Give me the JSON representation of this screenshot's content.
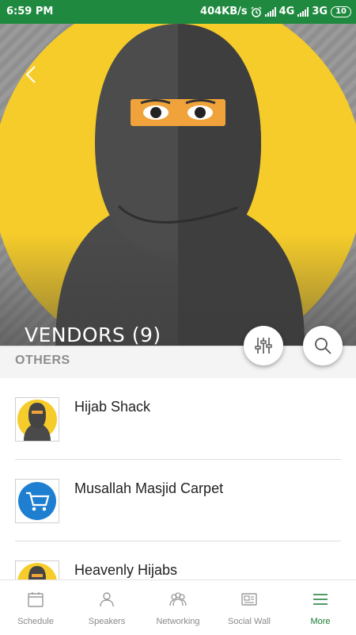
{
  "status_bar": {
    "time": "6:59 PM",
    "net_speed": "404KB/s",
    "signal_1": "4G",
    "signal_2": "3G",
    "battery": "10"
  },
  "header": {
    "title": "VENDORS (9)",
    "back_icon": "chevron-left-icon",
    "filter_icon": "sliders-icon",
    "search_icon": "search-icon"
  },
  "section": {
    "label": "OTHERS"
  },
  "vendors": [
    {
      "name": "Hijab Shack",
      "icon": "niqab-avatar-icon"
    },
    {
      "name": "Musallah Masjid Carpet",
      "icon": "shopping-cart-icon"
    },
    {
      "name": "Heavenly Hijabs",
      "icon": "niqab-avatar-icon"
    }
  ],
  "tabs": [
    {
      "label": "Schedule",
      "icon": "calendar-icon"
    },
    {
      "label": "Speakers",
      "icon": "person-icon"
    },
    {
      "label": "Networking",
      "icon": "people-icon"
    },
    {
      "label": "Social Wall",
      "icon": "news-icon"
    },
    {
      "label": "More",
      "icon": "menu-icon",
      "active": true
    }
  ],
  "colors": {
    "status_bar": "#1f8a3f",
    "accent": "#1a7a35",
    "avatar_yellow": "#f5cc2a"
  }
}
